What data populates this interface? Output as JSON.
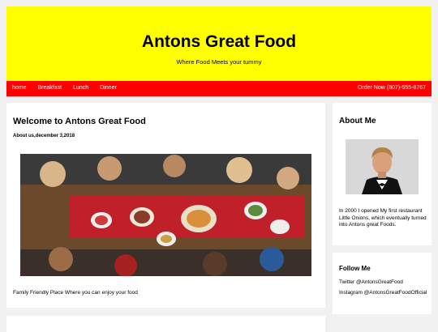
{
  "header": {
    "title": "Antons Great Food",
    "tagline": "Where Food Meets your tummy"
  },
  "nav": {
    "items": [
      "home",
      "Breakfast",
      "Lunch",
      "Dinner"
    ],
    "order": "Order Now (807)-555-8767"
  },
  "post": {
    "title": "Welcome to Antons Great Food",
    "meta": "About us,december 3,2018",
    "image_icon": "dinner-table-photo",
    "text": "Family Friendly Place Where you can enjoy your food"
  },
  "about": {
    "heading": "About Me",
    "photo_icon": "chef-portrait",
    "text": "In 2000 I opened My first restaurant Little Onions, which eventually turned into Antons great Foods."
  },
  "follow": {
    "heading": "Follow Me",
    "twitter": "Twitter @AntonsGreatFood",
    "instagram": "Instagram @AntonsGreatFoodOfficial"
  },
  "colors": {
    "header_bg": "#ffff00",
    "nav_bg": "#ff0000",
    "page_bg": "#f1f1f1"
  }
}
